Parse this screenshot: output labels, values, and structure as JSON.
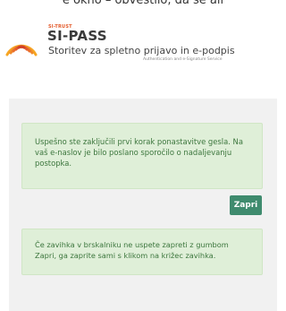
{
  "top_cut_text": "e okno – obvestilo, da se ali",
  "brand": {
    "small": "SI-TRUST",
    "title": "SI-PASS",
    "subtitle": "Storitev za spletno prijavo in e-podpis",
    "subtitle_en": "Authentication and e-Signature Service",
    "logo_colors": [
      "#f6a623",
      "#e35a2b",
      "#d0402a"
    ]
  },
  "message": {
    "text": "Uspešno ste zaključili prvi korak ponastavitve gesla. Na vaš e-naslov je bilo poslano sporočilo o nadaljevanju postopka."
  },
  "close_button": {
    "label": "Zapri",
    "color": "#3f8b6e"
  },
  "info": {
    "text": "Če zavihka v brskalniku ne uspete zapreti z gumbom Zapri, ga zaprite sami s klikom na križec zavihka."
  }
}
